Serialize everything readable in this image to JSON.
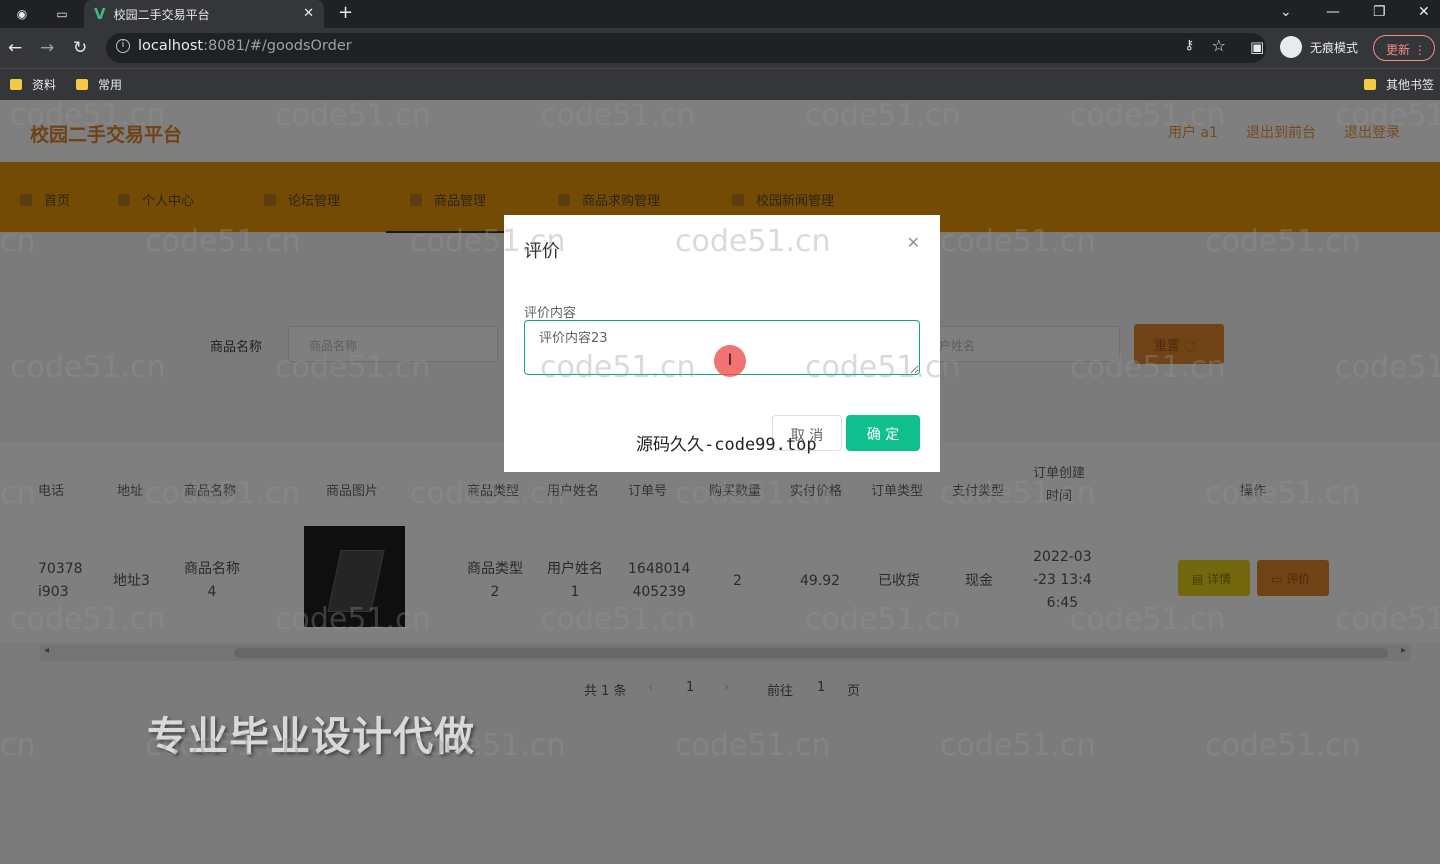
{
  "browser": {
    "tab_title": "校园二手交易平台",
    "url_host": "localhost",
    "url_path": ":8081/#/goodsOrder",
    "incognito_label": "无痕模式",
    "update_label": "更新",
    "bookmarks": [
      "资料",
      "常用"
    ],
    "other_bookmarks": "其他书签"
  },
  "app": {
    "brand": "校园二手交易平台",
    "header_links": [
      "用户 a1",
      "退出到前台",
      "退出登录"
    ],
    "menu": [
      "首页",
      "个人中心",
      "论坛管理",
      "商品管理",
      "商品求购管理",
      "校园新闻管理"
    ],
    "active_menu": "商品管理"
  },
  "search": {
    "label": "商品名称",
    "placeholder": "商品名称",
    "placeholder2": "户姓名",
    "reset_label": "重置"
  },
  "table": {
    "headers": [
      "电话",
      "地址",
      "商品名称",
      "商品图片",
      "商品类型",
      "用户姓名",
      "订单号",
      "购买数量",
      "实付价格",
      "订单类型",
      "支付类型",
      "订单创建时间",
      "操作"
    ],
    "header_split": {
      "a": "订单创建",
      "b": "时间"
    },
    "row": {
      "phone_a": "70378",
      "phone_b": "i903",
      "address": "地址3",
      "goods_name_a": "商品名称",
      "goods_name_b": "4",
      "goods_type_a": "商品类型",
      "goods_type_b": "2",
      "user_name_a": "用户姓名",
      "user_name_b": "1",
      "order_no_a": "1648014",
      "order_no_b": "405239",
      "quantity": "2",
      "price": "49.92",
      "order_type": "已收货",
      "pay_type": "现金",
      "created_a": "2022-03",
      "created_b": "-23 13:4",
      "created_c": "6:45",
      "detail_label": "详情",
      "eval_label": "评价"
    }
  },
  "pagination": {
    "total": "共 1 条",
    "current": "1",
    "goto": "前往",
    "goto_value": "1",
    "page_unit": "页"
  },
  "dialog": {
    "title": "评价",
    "field_label": "评价内容",
    "field_value": "评价内容23",
    "cancel_label": "取 消",
    "ok_label": "确 定"
  },
  "overlay_text": {
    "source_mark": "源码久久-code99.top",
    "promo": "专业毕业设计代做",
    "watermark": "code51.cn"
  }
}
